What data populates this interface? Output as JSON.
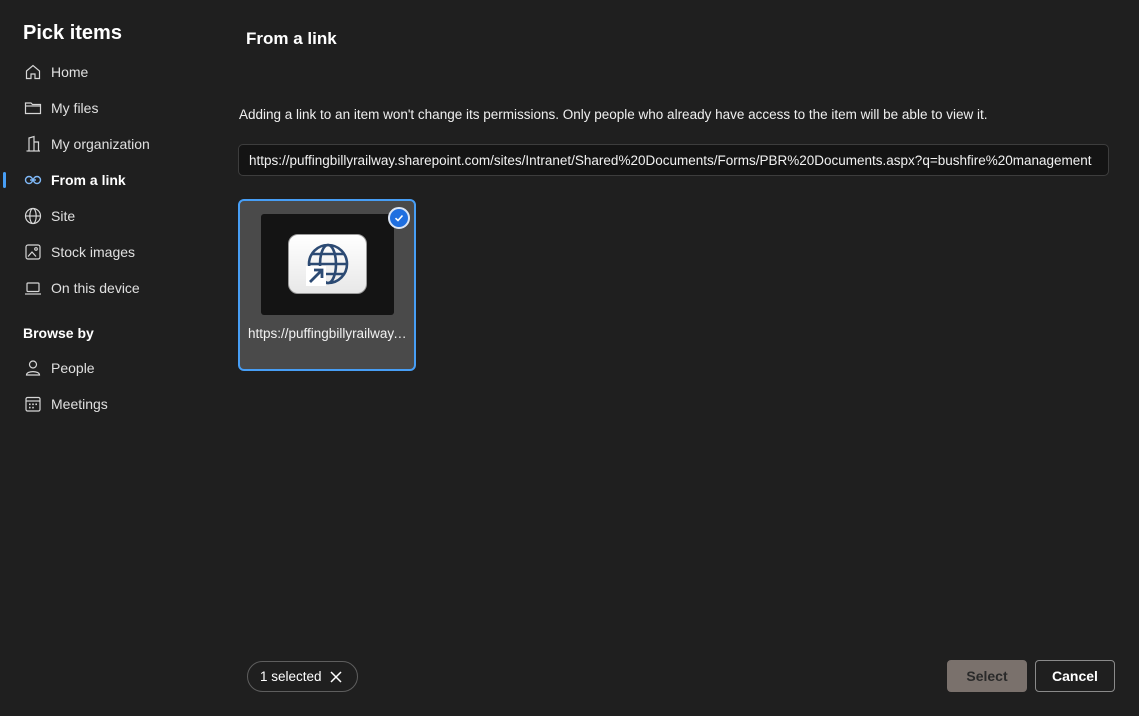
{
  "sidebar": {
    "title": "Pick items",
    "items": [
      {
        "label": "Home",
        "icon": "home-icon"
      },
      {
        "label": "My files",
        "icon": "folder-icon"
      },
      {
        "label": "My organization",
        "icon": "building-icon"
      },
      {
        "label": "From a link",
        "icon": "link-icon",
        "active": true
      },
      {
        "label": "Site",
        "icon": "globe-icon"
      },
      {
        "label": "Stock images",
        "icon": "image-icon"
      },
      {
        "label": "On this device",
        "icon": "laptop-icon"
      }
    ],
    "browse_heading": "Browse by",
    "browse_items": [
      {
        "label": "People",
        "icon": "person-icon"
      },
      {
        "label": "Meetings",
        "icon": "calendar-icon"
      }
    ]
  },
  "main": {
    "title": "From a link",
    "notice": "Adding a link to an item won't change its permissions. Only people who already have access to the item will be able to view it.",
    "url_value": "https://puffingbillyrailway.sharepoint.com/sites/Intranet/Shared%20Documents/Forms/PBR%20Documents.aspx?q=bushfire%20management",
    "tile": {
      "name": "https://puffingbillyrailway.sharepoint.com",
      "icon": "globe-link-icon",
      "selected": true
    }
  },
  "footer": {
    "selected_label": "1 selected",
    "select_label": "Select",
    "cancel_label": "Cancel"
  },
  "colors": {
    "background": "#1f1f1f",
    "accent": "#479ef5",
    "tile_background": "#4a4a4a",
    "select_button_disabled": "#7a716c"
  }
}
